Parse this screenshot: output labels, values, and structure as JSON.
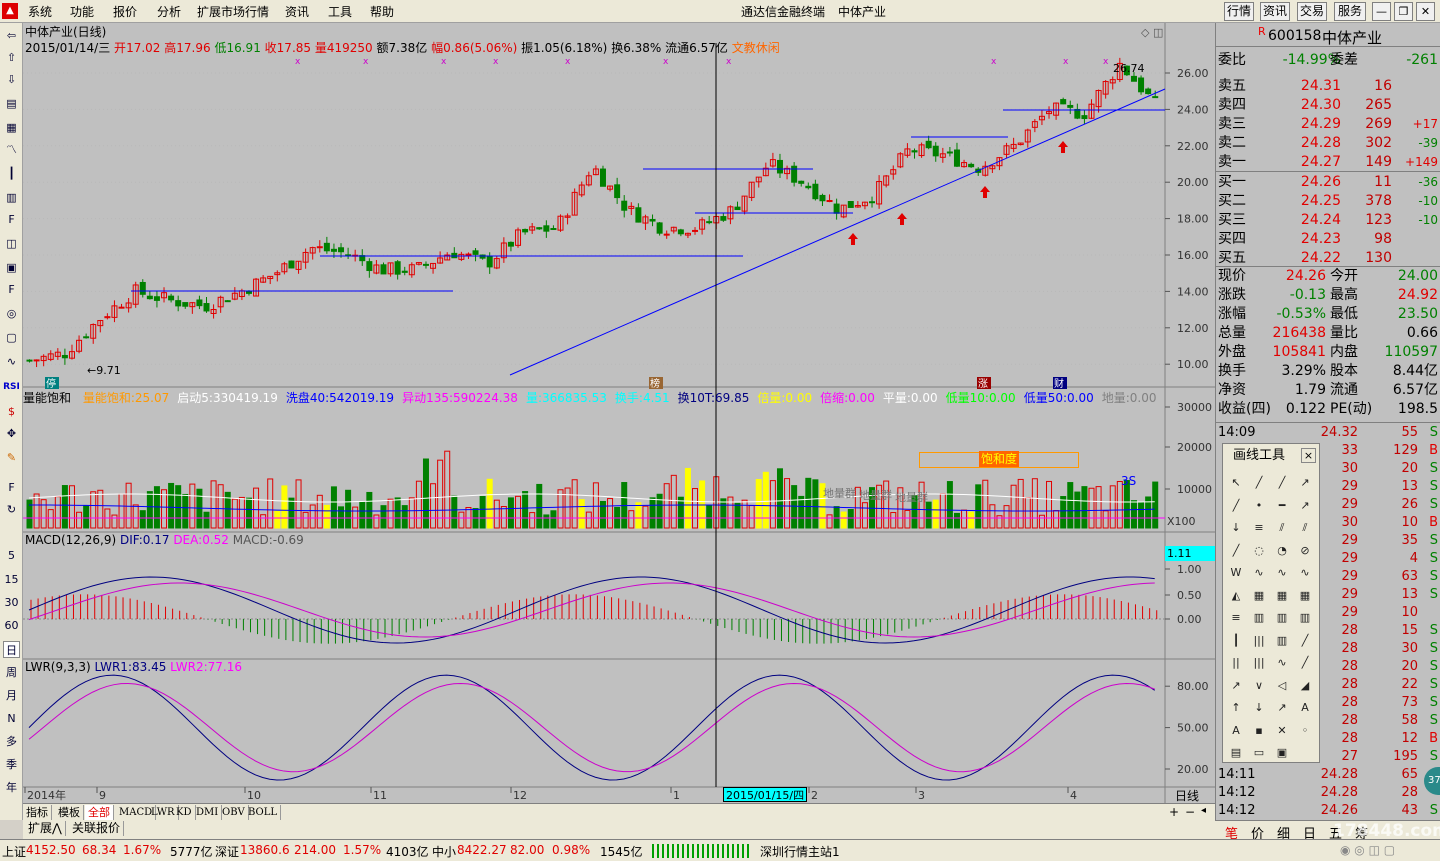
{
  "menu": [
    "系统",
    "功能",
    "报价",
    "分析",
    "扩展市场行情",
    "资讯",
    "工具",
    "帮助"
  ],
  "app_title": "通达信金融终端",
  "title_stock": "中体产业",
  "top_buttons": [
    "行情",
    "资讯",
    "交易",
    "服务"
  ],
  "chart_header": {
    "name": "中体产业(日线)",
    "date": "2015/01/14/三",
    "open_label": "开",
    "open": "17.02",
    "high_label": "高",
    "high": "17.96",
    "low_label": "低",
    "low": "16.91",
    "close_label": "收",
    "close": "17.85",
    "vol_label": "量",
    "vol": "419250",
    "amt_label": "额",
    "amt": "7.38亿",
    "range_label": "幅",
    "range": "0.86(5.06%)",
    "amp_label": "振",
    "amp": "1.05(6.18%)",
    "turn_label": "换",
    "turn": "6.38%",
    "float_label": "流通",
    "float": "6.57亿",
    "note": "文教休闲"
  },
  "price_axis": [
    "26.00",
    "24.00",
    "22.00",
    "20.00",
    "18.00",
    "16.00",
    "14.00",
    "12.00",
    "10.00"
  ],
  "price_marks": {
    "high": "26.74",
    "low": "9.71"
  },
  "chart_flags": [
    "停",
    "榜",
    "涨",
    "财"
  ],
  "vol_indicator": {
    "name": "量能饱和",
    "items": [
      {
        "label": "量能饱和:",
        "value": "25.07",
        "color": "#ff9900"
      },
      {
        "label": "启动5:",
        "value": "330419.19",
        "color": "#ffffff"
      },
      {
        "label": "洗盘40:",
        "value": "542019.19",
        "color": "#0000ff"
      },
      {
        "label": "异动135:",
        "value": "590224.38",
        "color": "#ff00ff"
      },
      {
        "label": "量:",
        "value": "366835.53",
        "color": "#00ffff"
      },
      {
        "label": "换手:",
        "value": "4.51",
        "color": "#00ffff"
      },
      {
        "label": "换10T:",
        "value": "69.85",
        "color": "#000080"
      },
      {
        "label": "倍量:",
        "value": "0.00",
        "color": "#ffff00"
      },
      {
        "label": "倍缩:",
        "value": "0.00",
        "color": "#ff00ff"
      },
      {
        "label": "平量:",
        "value": "0.00",
        "color": "#ffffff"
      },
      {
        "label": "低量10:",
        "value": "0.00",
        "color": "#00ff00"
      },
      {
        "label": "低量50:",
        "value": "0.00",
        "color": "#0000ff"
      },
      {
        "label": "地量:",
        "value": "0.00",
        "color": "#808080"
      }
    ],
    "axis": [
      "30000",
      "20000",
      "10000",
      "X100"
    ],
    "tags": [
      "饱和度",
      "3S"
    ],
    "ground_labels": [
      "地量群",
      "地量群",
      "地量群"
    ]
  },
  "macd": {
    "title": "MACD(12,26,9)",
    "dif_label": "DIF:",
    "dif": "0.17",
    "dea_label": "DEA:",
    "dea": "0.52",
    "macd_label": "MACD:",
    "macd": "-0.69",
    "axis": [
      "1.11",
      "1.00",
      "0.50",
      "0.00"
    ]
  },
  "lwr": {
    "title": "LWR(9,3,3)",
    "l1_label": "LWR1:",
    "l1": "83.45",
    "l2_label": "LWR2:",
    "l2": "77.16",
    "axis": [
      "80.00",
      "50.00",
      "20.00"
    ]
  },
  "x_axis": {
    "labels": [
      "2014年",
      "9",
      "10",
      "11",
      "12",
      "1",
      "2",
      "3",
      "4"
    ],
    "cursor": "2015/01/15/四",
    "period": "日线"
  },
  "left_periods": [
    "5",
    "15",
    "30",
    "60",
    "日",
    "周",
    "月",
    "N",
    "多",
    "季",
    "年"
  ],
  "bottom_tabs": [
    "指标",
    "模板",
    "全部",
    "MACD",
    "LWR",
    "KD",
    "DMI",
    "OBV",
    "BOLL"
  ],
  "bottom_tabs2": [
    "扩展⋀",
    "关联报价"
  ],
  "quote": {
    "code": "600158",
    "name": "中体产业",
    "wb_label": "委比",
    "wb": "-14.99%",
    "wc_label": "委差",
    "wc": "-261",
    "asks": [
      {
        "label": "卖五",
        "price": "24.31",
        "vol": "16",
        "chg": ""
      },
      {
        "label": "卖四",
        "price": "24.30",
        "vol": "265",
        "chg": ""
      },
      {
        "label": "卖三",
        "price": "24.29",
        "vol": "269",
        "chg": "+17"
      },
      {
        "label": "卖二",
        "price": "24.28",
        "vol": "302",
        "chg": "-39"
      },
      {
        "label": "卖一",
        "price": "24.27",
        "vol": "149",
        "chg": "+149"
      }
    ],
    "bids": [
      {
        "label": "买一",
        "price": "24.26",
        "vol": "11",
        "chg": "-36"
      },
      {
        "label": "买二",
        "price": "24.25",
        "vol": "378",
        "chg": "-10"
      },
      {
        "label": "买三",
        "price": "24.24",
        "vol": "123",
        "chg": "-10"
      },
      {
        "label": "买四",
        "price": "24.23",
        "vol": "98",
        "chg": ""
      },
      {
        "label": "买五",
        "price": "24.22",
        "vol": "130",
        "chg": ""
      }
    ],
    "stats": [
      {
        "l1": "现价",
        "v1": "24.26",
        "c1": "red",
        "l2": "今开",
        "v2": "24.00",
        "c2": "grn"
      },
      {
        "l1": "涨跌",
        "v1": "-0.13",
        "c1": "grn",
        "l2": "最高",
        "v2": "24.92",
        "c2": "red"
      },
      {
        "l1": "涨幅",
        "v1": "-0.53%",
        "c1": "grn",
        "l2": "最低",
        "v2": "23.50",
        "c2": "grn"
      },
      {
        "l1": "总量",
        "v1": "216438",
        "c1": "red",
        "l2": "量比",
        "v2": "0.66",
        "c2": "blk"
      },
      {
        "l1": "外盘",
        "v1": "105841",
        "c1": "red",
        "l2": "内盘",
        "v2": "110597",
        "c2": "grn"
      },
      {
        "l1": "换手",
        "v1": "3.29%",
        "c1": "blk",
        "l2": "股本",
        "v2": "8.44亿",
        "c2": "blk"
      },
      {
        "l1": "净资",
        "v1": "1.79",
        "c1": "blk",
        "l2": "流通",
        "v2": "6.57亿",
        "c2": "blk"
      },
      {
        "l1": "收益(四)",
        "v1": "0.122",
        "c1": "blk",
        "l2": "PE(动)",
        "v2": "198.5",
        "c2": "blk"
      }
    ],
    "ticks": [
      {
        "time": "14:09",
        "price": "24.32",
        "vol": "55",
        "bs": "S"
      },
      {
        "time": "",
        "price": "33",
        "vol": "129",
        "bs": "B"
      },
      {
        "time": "",
        "price": "30",
        "vol": "20",
        "bs": "S"
      },
      {
        "time": "",
        "price": "29",
        "vol": "13",
        "bs": "S"
      },
      {
        "time": "",
        "price": "29",
        "vol": "26",
        "bs": "S"
      },
      {
        "time": "",
        "price": "30",
        "vol": "10",
        "bs": "B"
      },
      {
        "time": "",
        "price": "29",
        "vol": "35",
        "bs": "S"
      },
      {
        "time": "",
        "price": "29",
        "vol": "4",
        "bs": "S"
      },
      {
        "time": "",
        "price": "29",
        "vol": "63",
        "bs": "S"
      },
      {
        "time": "",
        "price": "29",
        "vol": "13",
        "bs": "S"
      },
      {
        "time": "",
        "price": "29",
        "vol": "10",
        "bs": ""
      },
      {
        "time": "",
        "price": "28",
        "vol": "15",
        "bs": "S"
      },
      {
        "time": "",
        "price": "28",
        "vol": "30",
        "bs": "S"
      },
      {
        "time": "",
        "price": "28",
        "vol": "20",
        "bs": "S"
      },
      {
        "time": "",
        "price": "28",
        "vol": "22",
        "bs": "S"
      },
      {
        "time": "",
        "price": "28",
        "vol": "73",
        "bs": "S"
      },
      {
        "time": "",
        "price": "28",
        "vol": "58",
        "bs": "S"
      },
      {
        "time": "",
        "price": "28",
        "vol": "12",
        "bs": "B"
      },
      {
        "time": "",
        "price": "27",
        "vol": "195",
        "bs": "S"
      },
      {
        "time": "14:11",
        "price": "24.28",
        "vol": "65",
        "bs": ""
      },
      {
        "time": "14:12",
        "price": "24.28",
        "vol": "28",
        "bs": ""
      },
      {
        "time": "14:12",
        "price": "24.26",
        "vol": "43",
        "bs": "S"
      }
    ],
    "tabs": [
      "笔",
      "价",
      "细",
      "日",
      "五",
      "筹"
    ]
  },
  "draw_tool": {
    "title": "画线工具",
    "close": "×"
  },
  "status": {
    "sh_label": "上证",
    "sh": "4152.50",
    "sh_chg": "68.34",
    "sh_pct": "1.67%",
    "sh_amt": "5777亿",
    "sz_label": "深证",
    "sz": "13860.6",
    "sz_chg": "214.00",
    "sz_pct": "1.57%",
    "sz_amt": "4103亿",
    "zx_label": "中小",
    "zx": "8422.27",
    "zx_chg": "82.00",
    "zx_pct": "0.98%",
    "zx_amt": "1545亿",
    "server": "深圳行情主站1"
  },
  "watermark": "178448.com",
  "colors": {
    "up": "#e00000",
    "down": "#008000",
    "bg": "#c0c0c0",
    "trend": "#0000ff"
  }
}
